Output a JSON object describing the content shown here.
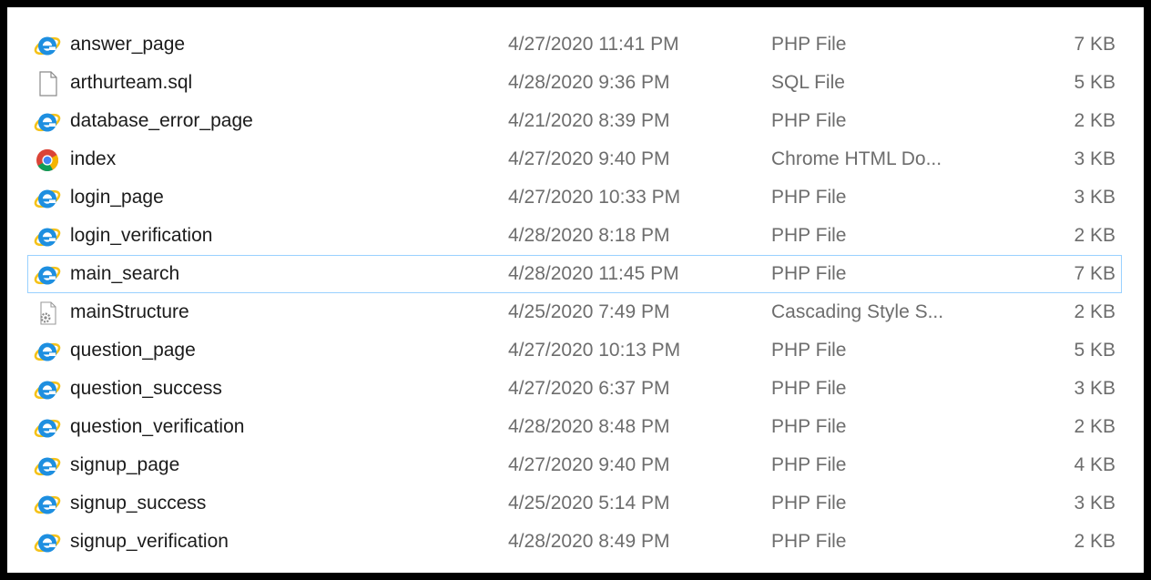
{
  "files": [
    {
      "name": "answer_page",
      "date": "4/27/2020 11:41 PM",
      "type": "PHP File",
      "size": "7 KB",
      "icon": "ie-php-file-icon",
      "focused": false
    },
    {
      "name": "arthurteam.sql",
      "date": "4/28/2020 9:36 PM",
      "type": "SQL File",
      "size": "5 KB",
      "icon": "blank-document-icon",
      "focused": false
    },
    {
      "name": "database_error_page",
      "date": "4/21/2020 8:39 PM",
      "type": "PHP File",
      "size": "2 KB",
      "icon": "ie-php-file-icon",
      "focused": false
    },
    {
      "name": "index",
      "date": "4/27/2020 9:40 PM",
      "type": "Chrome HTML Do...",
      "size": "3 KB",
      "icon": "chrome-icon",
      "focused": false
    },
    {
      "name": "login_page",
      "date": "4/27/2020 10:33 PM",
      "type": "PHP File",
      "size": "3 KB",
      "icon": "ie-php-file-icon",
      "focused": false
    },
    {
      "name": "login_verification",
      "date": "4/28/2020 8:18 PM",
      "type": "PHP File",
      "size": "2 KB",
      "icon": "ie-php-file-icon",
      "focused": false
    },
    {
      "name": "main_search",
      "date": "4/28/2020 11:45 PM",
      "type": "PHP File",
      "size": "7 KB",
      "icon": "ie-php-file-icon",
      "focused": true
    },
    {
      "name": "mainStructure",
      "date": "4/25/2020 7:49 PM",
      "type": "Cascading Style S...",
      "size": "2 KB",
      "icon": "css-gear-file-icon",
      "focused": false
    },
    {
      "name": "question_page",
      "date": "4/27/2020 10:13 PM",
      "type": "PHP File",
      "size": "5 KB",
      "icon": "ie-php-file-icon",
      "focused": false
    },
    {
      "name": "question_success",
      "date": "4/27/2020 6:37 PM",
      "type": "PHP File",
      "size": "3 KB",
      "icon": "ie-php-file-icon",
      "focused": false
    },
    {
      "name": "question_verification",
      "date": "4/28/2020 8:48 PM",
      "type": "PHP File",
      "size": "2 KB",
      "icon": "ie-php-file-icon",
      "focused": false
    },
    {
      "name": "signup_page",
      "date": "4/27/2020 9:40 PM",
      "type": "PHP File",
      "size": "4 KB",
      "icon": "ie-php-file-icon",
      "focused": false
    },
    {
      "name": "signup_success",
      "date": "4/25/2020 5:14 PM",
      "type": "PHP File",
      "size": "3 KB",
      "icon": "ie-php-file-icon",
      "focused": false
    },
    {
      "name": "signup_verification",
      "date": "4/28/2020 8:49 PM",
      "type": "PHP File",
      "size": "2 KB",
      "icon": "ie-php-file-icon",
      "focused": false
    }
  ],
  "colors": {
    "text_primary": "#1b1b1b",
    "text_secondary": "#6d6d6d",
    "focus_border": "#99d1ff",
    "ie_blue": "#1e8fe0",
    "ie_ring": "#f5c21a"
  }
}
